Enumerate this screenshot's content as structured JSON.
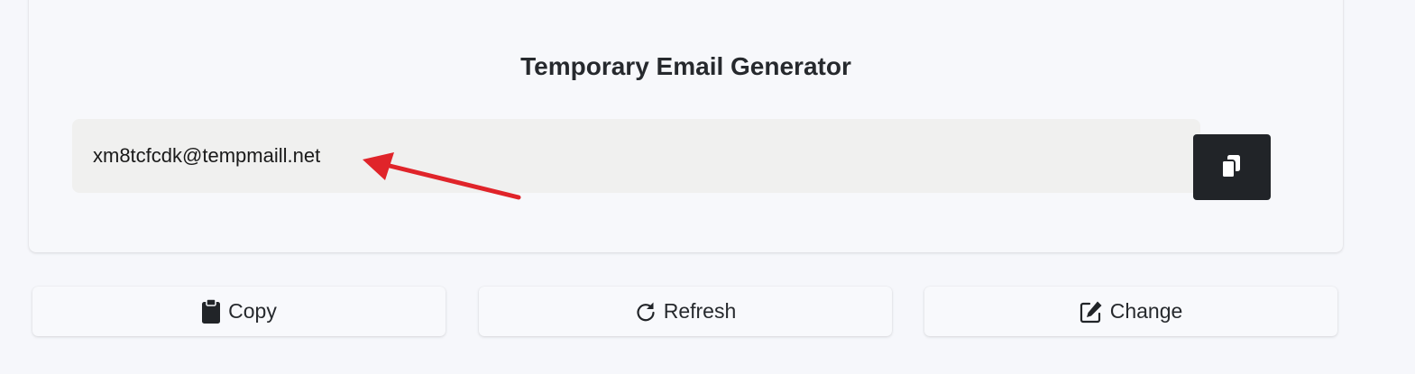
{
  "generator": {
    "title": "Temporary Email Generator",
    "email": "xm8tcfcdk@tempmaill.net",
    "copy_icon": "copy-icon"
  },
  "actions": [
    {
      "label": "Copy",
      "icon": "clipboard-icon"
    },
    {
      "label": "Refresh",
      "icon": "refresh-icon"
    },
    {
      "label": "Change",
      "icon": "edit-icon"
    }
  ],
  "colors": {
    "page_background": "#f6f7fb",
    "email_box": "#f0f0ef",
    "dark_button": "#212428",
    "annotation_arrow": "#e0242a"
  }
}
